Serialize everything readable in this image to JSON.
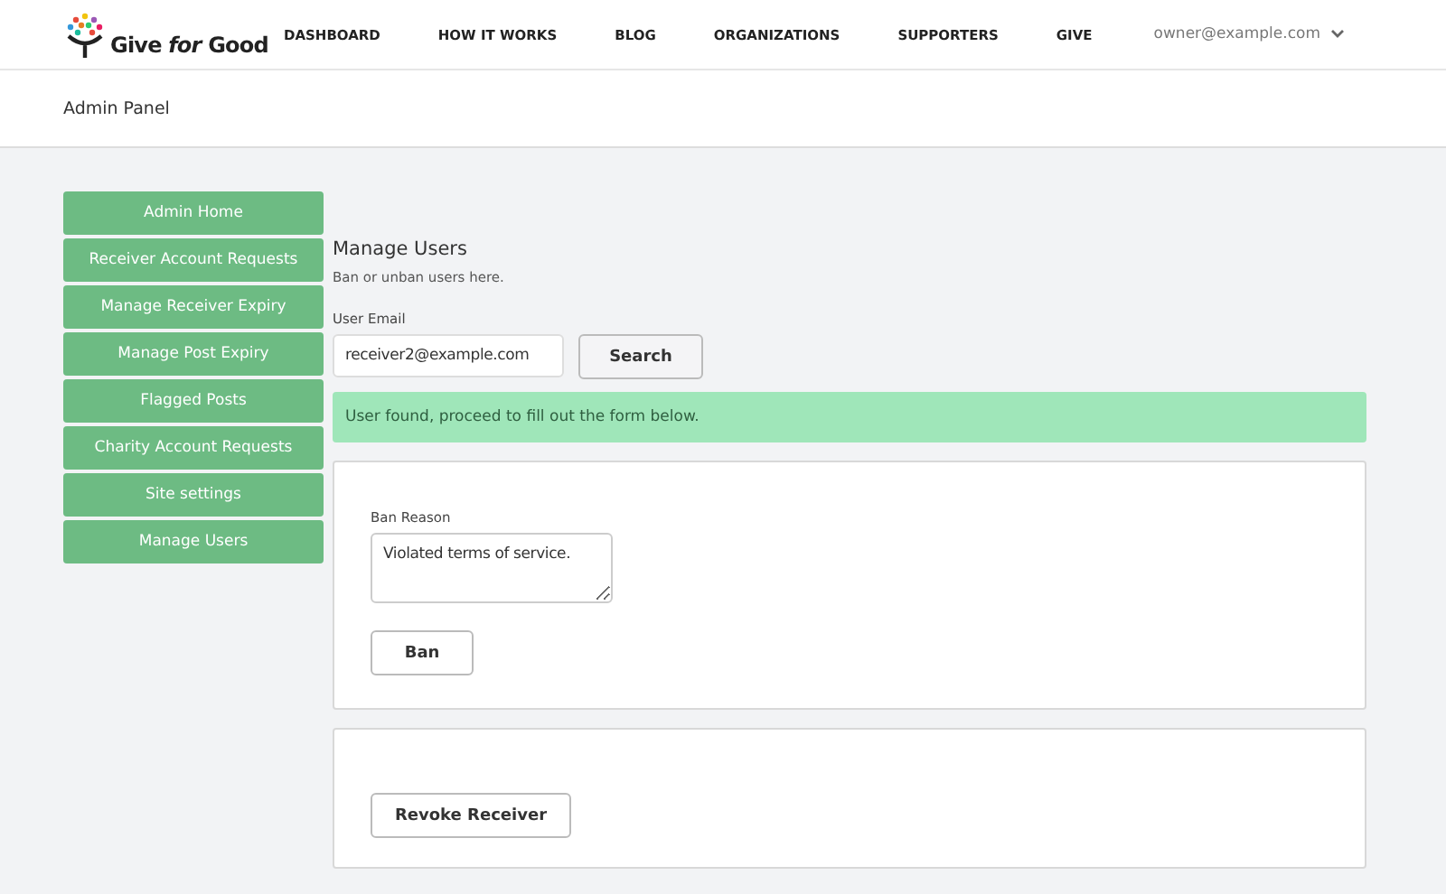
{
  "brand": {
    "name": "Give *for* Good"
  },
  "nav": [
    "DASHBOARD",
    "HOW IT WORKS",
    "BLOG",
    "ORGANIZATIONS",
    "SUPPORTERS",
    "GIVE"
  ],
  "account": {
    "email": "owner@example.com"
  },
  "page_title": "Admin Panel",
  "sidebar": {
    "items": [
      "Admin Home",
      "Receiver Account Requests",
      "Manage Receiver Expiry",
      "Manage Post Expiry",
      "Flagged Posts",
      "Charity Account Requests",
      "Site settings",
      "Manage Users"
    ]
  },
  "main": {
    "title": "Manage Users",
    "subtitle": "Ban or unban users here.",
    "email_label": "User Email",
    "email_value": "receiver2@example.com",
    "search_button": "Search",
    "alert": "User found, proceed to fill out the form below.",
    "ban_label": "Ban Reason",
    "ban_value": "Violated terms of service.",
    "ban_button": "Ban",
    "revoke_button": "Revoke Receiver"
  }
}
